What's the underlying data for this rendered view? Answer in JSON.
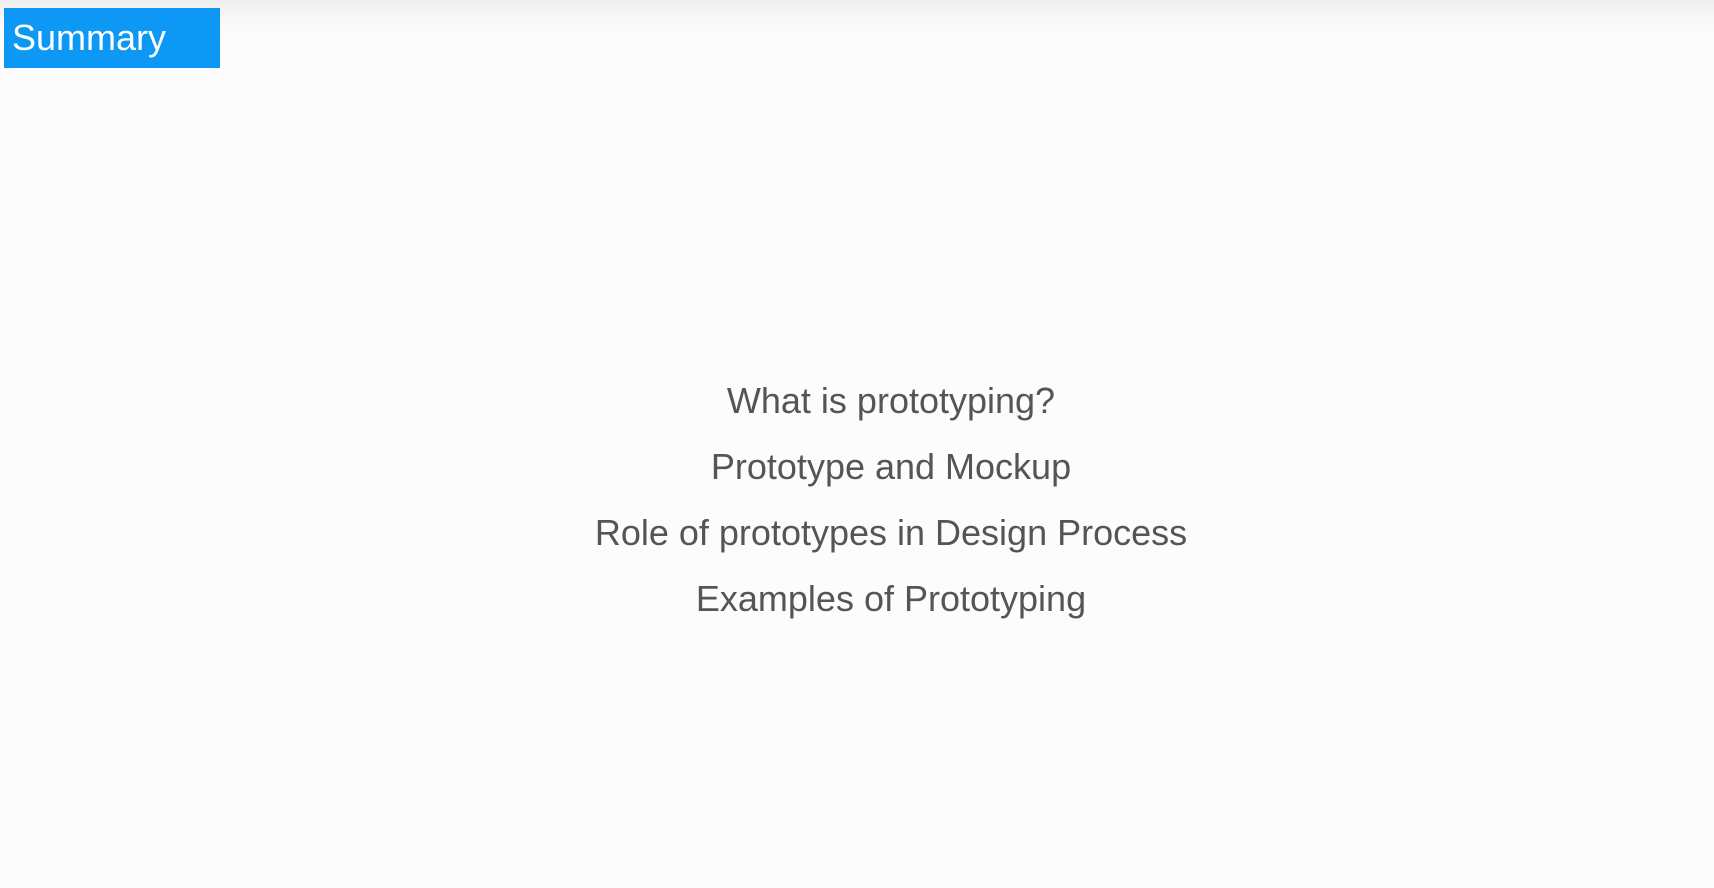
{
  "slide": {
    "section_tag": "Summary",
    "items": [
      "What is prototyping?",
      "Prototype and Mockup",
      "Role of prototypes in Design Process",
      "Examples of Prototyping"
    ]
  },
  "colors": {
    "background": "#fcfcfc",
    "tag_background": "#0e98f6",
    "tag_text": "#ffffff",
    "item_text": "#555555"
  }
}
